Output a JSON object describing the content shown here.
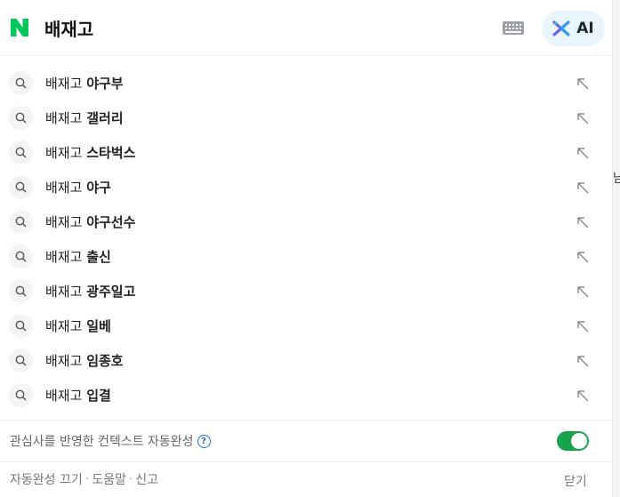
{
  "header": {
    "query": "배재고",
    "ai_label": "AI"
  },
  "suggestions": [
    {
      "base": "배재고",
      "suffix": "야구부"
    },
    {
      "base": "배재고",
      "suffix": "갤러리"
    },
    {
      "base": "배재고",
      "suffix": "스타벅스"
    },
    {
      "base": "배재고",
      "suffix": "야구"
    },
    {
      "base": "배재고",
      "suffix": "야구선수"
    },
    {
      "base": "배재고",
      "suffix": "출신"
    },
    {
      "base": "배재고",
      "suffix": "광주일고"
    },
    {
      "base": "배재고",
      "suffix": "일베"
    },
    {
      "base": "배재고",
      "suffix": "임종호"
    },
    {
      "base": "배재고",
      "suffix": "입결"
    }
  ],
  "context": {
    "label": "관심사를 반영한 컨텍스트 자동완성",
    "help": "?"
  },
  "footer": {
    "autocomplete_off": "자동완성 끄기",
    "help": "도움말",
    "report": "신고",
    "close": "닫기"
  },
  "colors": {
    "naver_green": "#03c75a",
    "toggle_on": "#17a34a",
    "help_blue": "#1d6fd8"
  }
}
